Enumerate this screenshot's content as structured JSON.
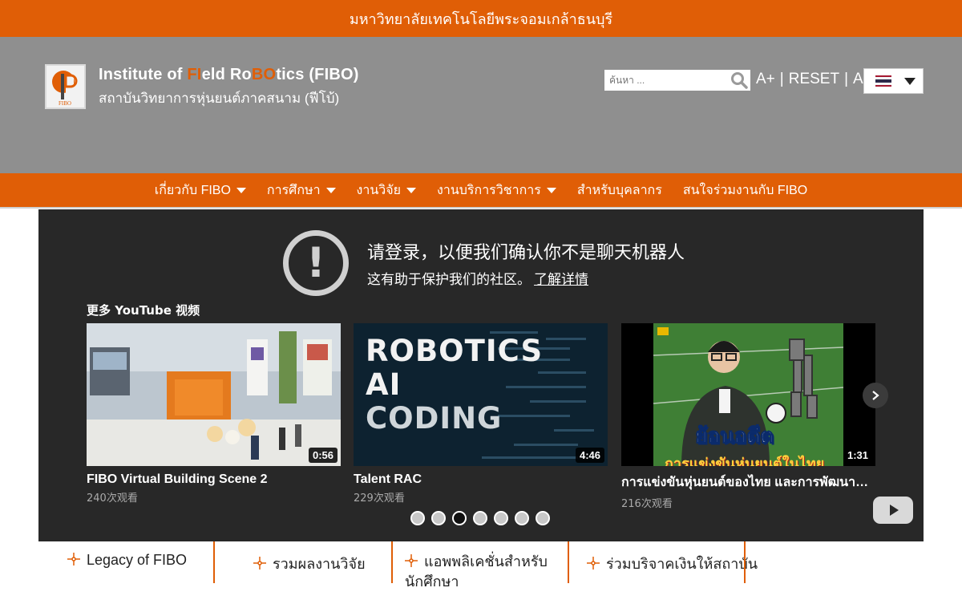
{
  "topbar": {
    "university": "มหาวิทยาลัยเทคโนโลยีพระจอมเกล้าธนบุรี"
  },
  "brand": {
    "en_parts": [
      "Institute of ",
      "FI",
      "eld Ro",
      "BO",
      "tics (FIBO)"
    ],
    "th": "สถาบันวิทยาการหุ่นยนต์ภาคสนาม (ฟีโบ้)",
    "logo_text": "FIBO"
  },
  "search": {
    "placeholder": "ค้นหา ..."
  },
  "font_controls": {
    "increase": "A+",
    "reset": "RESET",
    "decrease": "A-",
    "separator": "|"
  },
  "language": {
    "flag": "thai-flag",
    "colors": [
      "#a51931",
      "#f4f5f8",
      "#2d2a4a",
      "#2d2a4a",
      "#f4f5f8",
      "#a51931"
    ]
  },
  "nav": {
    "items": [
      {
        "label": "เกี่ยวกับ FIBO",
        "dropdown": true
      },
      {
        "label": "การศึกษา",
        "dropdown": true
      },
      {
        "label": "งานวิจัย",
        "dropdown": true
      },
      {
        "label": "งานบริการวิชาการ",
        "dropdown": true
      },
      {
        "label": "สำหรับบุคลากร",
        "dropdown": false
      },
      {
        "label": "สนใจร่วมงานกับ FIBO",
        "dropdown": false
      }
    ]
  },
  "youtube": {
    "title": "请登录，以便我们确认你不是聊天机器人",
    "subtitle": "这有助于保护我们的社区。",
    "learn_more": "了解详情",
    "more_videos": "更多 YouTube 视频",
    "videos": [
      {
        "title": "FIBO Virtual Building Scene 2",
        "views": "240次观看",
        "duration": "0:56"
      },
      {
        "title": "Talent RAC",
        "views": "229次观看",
        "duration": "4:46",
        "thumb_text": [
          "ROBOTICS",
          "AI",
          "CODING"
        ]
      },
      {
        "title": "การแข่งขันหุ่นยนต์ของไทย และการพัฒนาทีมหุ่นยนต์",
        "views": "216次观看",
        "duration": "1:31",
        "thumb_text": [
          "ย้อนอดีต",
          "การแข่งขันหุ่นยนต์ในไทย"
        ]
      }
    ],
    "pages": 7,
    "active_page": 3
  },
  "quick_links": [
    {
      "label": "Legacy of FIBO"
    },
    {
      "label": "รวมผลงานวิจัย"
    },
    {
      "label": "แอพพลิเคชั่นสำหรับนักศึกษา"
    },
    {
      "label": "ร่วมบริจาคเงินให้สถาบัน"
    }
  ],
  "colors": {
    "brand_orange": "#e05e06",
    "header_gray": "#8f8f8f",
    "yt_dark": "#282828"
  }
}
